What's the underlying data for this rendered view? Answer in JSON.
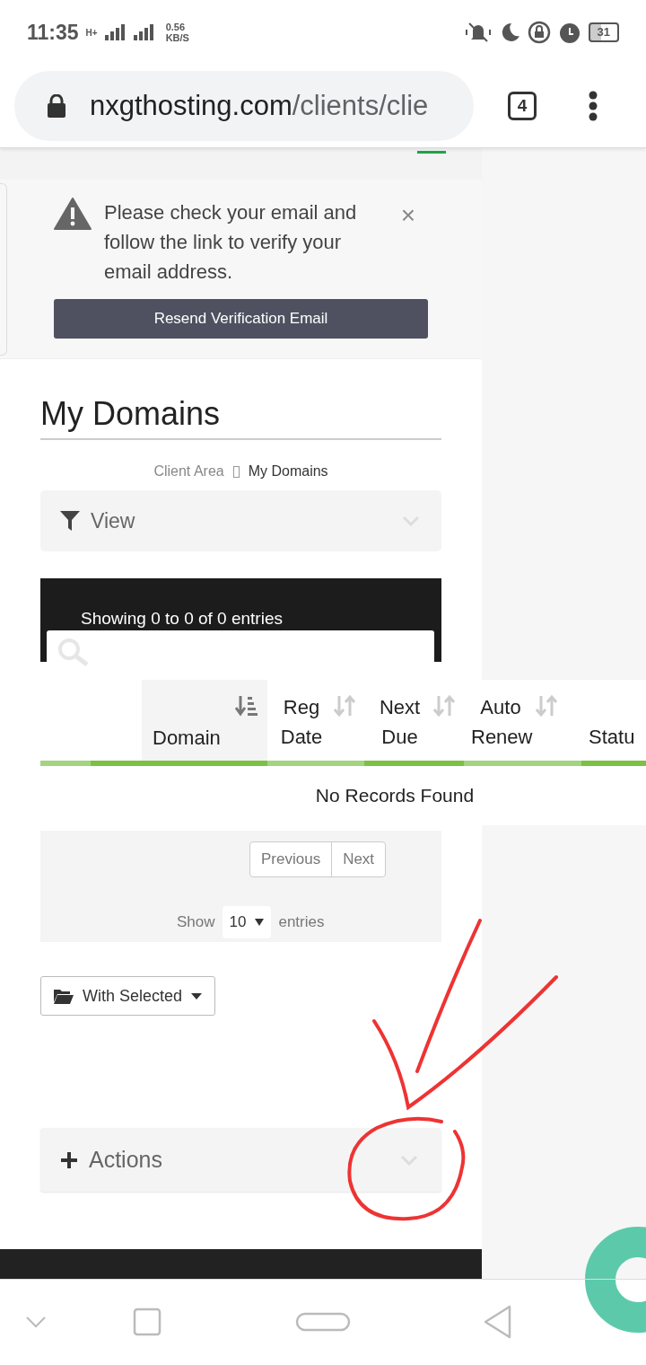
{
  "status_bar": {
    "time": "11:35",
    "network": "H+",
    "speed": "0.56",
    "speed_unit": "KB/S",
    "battery": "31"
  },
  "browser": {
    "domain": "nxgthosting.com",
    "path": "/clients/clie",
    "tab_count": "4"
  },
  "alert": {
    "message": "Please check your email and follow the link to verify your email address.",
    "close": "×",
    "button": "Resend Verification Email"
  },
  "page": {
    "title": "My Domains",
    "breadcrumb": [
      {
        "label": "Client Area",
        "current": false
      },
      {
        "label": "My Domains",
        "current": true
      }
    ]
  },
  "view_filter": {
    "label": "View"
  },
  "table": {
    "info": "Showing 0 to 0 of 0 entries",
    "columns": [
      {
        "label": "Domain",
        "sorted": true
      },
      {
        "label": "Reg Date",
        "sorted": false
      },
      {
        "label": "Next Due",
        "sorted": false
      },
      {
        "label": "Auto Renew",
        "sorted": false
      },
      {
        "label": "Statu"
      }
    ],
    "empty": "No Records Found"
  },
  "pagination": {
    "buttons": [
      "Previous",
      "Next"
    ],
    "show": "Show",
    "page_size": "10",
    "entries": "entries"
  },
  "with_selected": "With Selected",
  "actions": {
    "label": "Actions"
  }
}
